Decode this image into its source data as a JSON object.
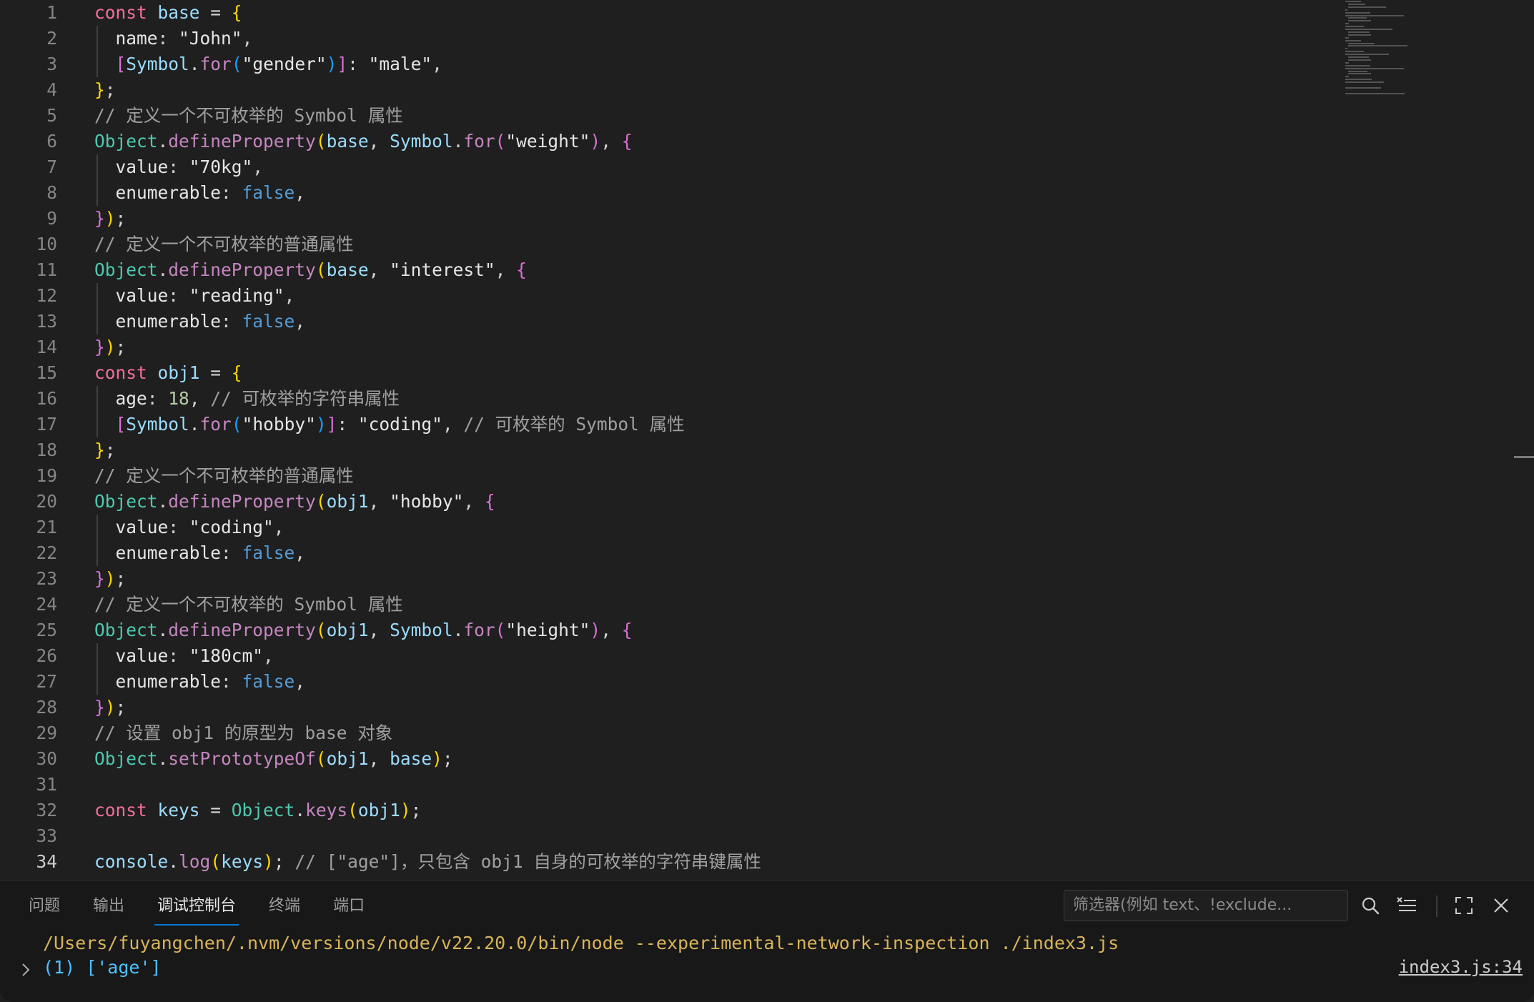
{
  "editor": {
    "lines": [
      {
        "n": "1",
        "guide": false,
        "tokens": [
          [
            "kw",
            "const "
          ],
          [
            "var",
            "base"
          ],
          [
            "op",
            " = "
          ],
          [
            "b1",
            "{"
          ]
        ]
      },
      {
        "n": "2",
        "guide": true,
        "tokens": [
          [
            "prop",
            "  name"
          ],
          [
            "op",
            ": "
          ],
          [
            "str",
            "\"John\""
          ],
          [
            "op",
            ","
          ]
        ]
      },
      {
        "n": "3",
        "guide": true,
        "tokens": [
          [
            "b2",
            "  ["
          ],
          [
            "var",
            "Symbol"
          ],
          [
            "op",
            "."
          ],
          [
            "fn2",
            "for"
          ],
          [
            "b3",
            "("
          ],
          [
            "str",
            "\"gender\""
          ],
          [
            "b3",
            ")"
          ],
          [
            "b2",
            "]"
          ],
          [
            "op",
            ": "
          ],
          [
            "str",
            "\"male\""
          ],
          [
            "op",
            ","
          ]
        ]
      },
      {
        "n": "4",
        "guide": false,
        "tokens": [
          [
            "b1",
            "}"
          ],
          [
            "op",
            ";"
          ]
        ]
      },
      {
        "n": "5",
        "guide": false,
        "tokens": [
          [
            "cmt",
            "// 定义一个不可枚举的 Symbol 属性"
          ]
        ]
      },
      {
        "n": "6",
        "guide": false,
        "tokens": [
          [
            "cls",
            "Object"
          ],
          [
            "op",
            "."
          ],
          [
            "fn2",
            "defineProperty"
          ],
          [
            "b1",
            "("
          ],
          [
            "var",
            "base"
          ],
          [
            "op",
            ", "
          ],
          [
            "var",
            "Symbol"
          ],
          [
            "op",
            "."
          ],
          [
            "fn2",
            "for"
          ],
          [
            "b2",
            "("
          ],
          [
            "str",
            "\"weight\""
          ],
          [
            "b2",
            ")"
          ],
          [
            "op",
            ", "
          ],
          [
            "b2",
            "{"
          ]
        ]
      },
      {
        "n": "7",
        "guide": true,
        "tokens": [
          [
            "prop",
            "  value"
          ],
          [
            "op",
            ": "
          ],
          [
            "str",
            "\"70kg\""
          ],
          [
            "op",
            ","
          ]
        ]
      },
      {
        "n": "8",
        "guide": true,
        "tokens": [
          [
            "prop",
            "  enumerable"
          ],
          [
            "op",
            ": "
          ],
          [
            "bool",
            "false"
          ],
          [
            "op",
            ","
          ]
        ]
      },
      {
        "n": "9",
        "guide": false,
        "tokens": [
          [
            "b2",
            "}"
          ],
          [
            "b1",
            ")"
          ],
          [
            "op",
            ";"
          ]
        ]
      },
      {
        "n": "10",
        "guide": false,
        "tokens": [
          [
            "cmt",
            "// 定义一个不可枚举的普通属性"
          ]
        ]
      },
      {
        "n": "11",
        "guide": false,
        "tokens": [
          [
            "cls",
            "Object"
          ],
          [
            "op",
            "."
          ],
          [
            "fn2",
            "defineProperty"
          ],
          [
            "b1",
            "("
          ],
          [
            "var",
            "base"
          ],
          [
            "op",
            ", "
          ],
          [
            "str",
            "\"interest\""
          ],
          [
            "op",
            ", "
          ],
          [
            "b2",
            "{"
          ]
        ]
      },
      {
        "n": "12",
        "guide": true,
        "tokens": [
          [
            "prop",
            "  value"
          ],
          [
            "op",
            ": "
          ],
          [
            "str",
            "\"reading\""
          ],
          [
            "op",
            ","
          ]
        ]
      },
      {
        "n": "13",
        "guide": true,
        "tokens": [
          [
            "prop",
            "  enumerable"
          ],
          [
            "op",
            ": "
          ],
          [
            "bool",
            "false"
          ],
          [
            "op",
            ","
          ]
        ]
      },
      {
        "n": "14",
        "guide": false,
        "tokens": [
          [
            "b2",
            "}"
          ],
          [
            "b1",
            ")"
          ],
          [
            "op",
            ";"
          ]
        ]
      },
      {
        "n": "15",
        "guide": false,
        "tokens": [
          [
            "kw",
            "const "
          ],
          [
            "var",
            "obj1"
          ],
          [
            "op",
            " = "
          ],
          [
            "b1",
            "{"
          ]
        ]
      },
      {
        "n": "16",
        "guide": true,
        "tokens": [
          [
            "prop",
            "  age"
          ],
          [
            "op",
            ": "
          ],
          [
            "num",
            "18"
          ],
          [
            "op",
            ", "
          ],
          [
            "cmt",
            "// 可枚举的字符串属性"
          ]
        ]
      },
      {
        "n": "17",
        "guide": true,
        "tokens": [
          [
            "b2",
            "  ["
          ],
          [
            "var",
            "Symbol"
          ],
          [
            "op",
            "."
          ],
          [
            "fn2",
            "for"
          ],
          [
            "b3",
            "("
          ],
          [
            "str",
            "\"hobby\""
          ],
          [
            "b3",
            ")"
          ],
          [
            "b2",
            "]"
          ],
          [
            "op",
            ": "
          ],
          [
            "str",
            "\"coding\""
          ],
          [
            "op",
            ", "
          ],
          [
            "cmt",
            "// 可枚举的 Symbol 属性"
          ]
        ]
      },
      {
        "n": "18",
        "guide": false,
        "tokens": [
          [
            "b1",
            "}"
          ],
          [
            "op",
            ";"
          ]
        ]
      },
      {
        "n": "19",
        "guide": false,
        "tokens": [
          [
            "cmt",
            "// 定义一个不可枚举的普通属性"
          ]
        ]
      },
      {
        "n": "20",
        "guide": false,
        "tokens": [
          [
            "cls",
            "Object"
          ],
          [
            "op",
            "."
          ],
          [
            "fn2",
            "defineProperty"
          ],
          [
            "b1",
            "("
          ],
          [
            "var",
            "obj1"
          ],
          [
            "op",
            ", "
          ],
          [
            "str",
            "\"hobby\""
          ],
          [
            "op",
            ", "
          ],
          [
            "b2",
            "{"
          ]
        ]
      },
      {
        "n": "21",
        "guide": true,
        "tokens": [
          [
            "prop",
            "  value"
          ],
          [
            "op",
            ": "
          ],
          [
            "str",
            "\"coding\""
          ],
          [
            "op",
            ","
          ]
        ]
      },
      {
        "n": "22",
        "guide": true,
        "tokens": [
          [
            "prop",
            "  enumerable"
          ],
          [
            "op",
            ": "
          ],
          [
            "bool",
            "false"
          ],
          [
            "op",
            ","
          ]
        ]
      },
      {
        "n": "23",
        "guide": false,
        "tokens": [
          [
            "b2",
            "}"
          ],
          [
            "b1",
            ")"
          ],
          [
            "op",
            ";"
          ]
        ]
      },
      {
        "n": "24",
        "guide": false,
        "tokens": [
          [
            "cmt",
            "// 定义一个不可枚举的 Symbol 属性"
          ]
        ]
      },
      {
        "n": "25",
        "guide": false,
        "tokens": [
          [
            "cls",
            "Object"
          ],
          [
            "op",
            "."
          ],
          [
            "fn2",
            "defineProperty"
          ],
          [
            "b1",
            "("
          ],
          [
            "var",
            "obj1"
          ],
          [
            "op",
            ", "
          ],
          [
            "var",
            "Symbol"
          ],
          [
            "op",
            "."
          ],
          [
            "fn2",
            "for"
          ],
          [
            "b2",
            "("
          ],
          [
            "str",
            "\"height\""
          ],
          [
            "b2",
            ")"
          ],
          [
            "op",
            ", "
          ],
          [
            "b2",
            "{"
          ]
        ]
      },
      {
        "n": "26",
        "guide": true,
        "tokens": [
          [
            "prop",
            "  value"
          ],
          [
            "op",
            ": "
          ],
          [
            "str",
            "\"180cm\""
          ],
          [
            "op",
            ","
          ]
        ]
      },
      {
        "n": "27",
        "guide": true,
        "tokens": [
          [
            "prop",
            "  enumerable"
          ],
          [
            "op",
            ": "
          ],
          [
            "bool",
            "false"
          ],
          [
            "op",
            ","
          ]
        ]
      },
      {
        "n": "28",
        "guide": false,
        "tokens": [
          [
            "b2",
            "}"
          ],
          [
            "b1",
            ")"
          ],
          [
            "op",
            ";"
          ]
        ]
      },
      {
        "n": "29",
        "guide": false,
        "tokens": [
          [
            "cmt",
            "// 设置 obj1 的原型为 base 对象"
          ]
        ]
      },
      {
        "n": "30",
        "guide": false,
        "tokens": [
          [
            "cls",
            "Object"
          ],
          [
            "op",
            "."
          ],
          [
            "fn2",
            "setPrototypeOf"
          ],
          [
            "b1",
            "("
          ],
          [
            "var",
            "obj1"
          ],
          [
            "op",
            ", "
          ],
          [
            "var",
            "base"
          ],
          [
            "b1",
            ")"
          ],
          [
            "op",
            ";"
          ]
        ]
      },
      {
        "n": "31",
        "guide": false,
        "tokens": []
      },
      {
        "n": "32",
        "guide": false,
        "tokens": [
          [
            "kw",
            "const "
          ],
          [
            "var",
            "keys"
          ],
          [
            "op",
            " = "
          ],
          [
            "cls",
            "Object"
          ],
          [
            "op",
            "."
          ],
          [
            "fn2",
            "keys"
          ],
          [
            "b1",
            "("
          ],
          [
            "var",
            "obj1"
          ],
          [
            "b1",
            ")"
          ],
          [
            "op",
            ";"
          ]
        ]
      },
      {
        "n": "33",
        "guide": false,
        "tokens": []
      },
      {
        "n": "34",
        "guide": false,
        "tokens": [
          [
            "var",
            "console"
          ],
          [
            "op",
            "."
          ],
          [
            "fn2",
            "log"
          ],
          [
            "b1",
            "("
          ],
          [
            "var",
            "keys"
          ],
          [
            "b1",
            ")"
          ],
          [
            "op",
            "; "
          ],
          [
            "cmt",
            "// [\"age\"]，只包含 obj1 自身的可枚举的字符串键属性"
          ]
        ]
      }
    ]
  },
  "panel": {
    "tabs": [
      "问题",
      "输出",
      "调试控制台",
      "终端",
      "端口"
    ],
    "active_tab": "调试控制台",
    "filter_placeholder": "筛选器(例如 text、!exclude...",
    "output_command": "/Users/fuyangchen/.nvm/versions/node/v22.20.0/bin/node --experimental-network-inspection ./index3.js",
    "output_result": "(1) ['age']",
    "output_source": "index3.js:34",
    "icons": [
      "search-icon",
      "clear-filter-icon",
      "maximize-icon",
      "close-icon"
    ]
  }
}
